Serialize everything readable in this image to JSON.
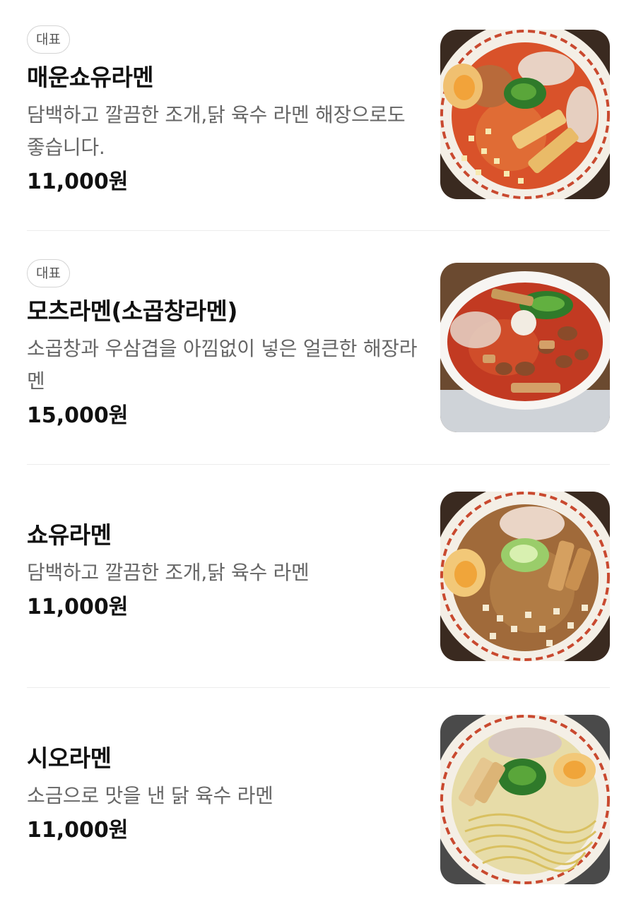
{
  "menu": {
    "items": [
      {
        "badge": "대표",
        "name": "매운쇼유라멘",
        "description": "담백하고 깔끔한 조개,닭 육수 라멘 해장으로도 좋습니다.",
        "price": "11,000원",
        "image_icon": "spicy-shoyu-ramen-photo"
      },
      {
        "badge": "대표",
        "name": "모츠라멘(소곱창라멘)",
        "description": "소곱창과 우삼겹을 아낌없이 넣은 얼큰한 해장라멘",
        "price": "15,000원",
        "image_icon": "motsu-ramen-photo"
      },
      {
        "name": "쇼유라멘",
        "description": "담백하고 깔끔한 조개,닭 육수 라멘",
        "price": "11,000원",
        "image_icon": "shoyu-ramen-photo"
      },
      {
        "name": "시오라멘",
        "description": "소금으로 맛을 낸 닭 육수 라멘",
        "price": "11,000원",
        "image_icon": "shio-ramen-photo"
      }
    ]
  },
  "colors": {
    "text_primary": "#111111",
    "text_secondary": "#666666",
    "badge_border": "#d4d4d4",
    "divider": "#ececec"
  }
}
